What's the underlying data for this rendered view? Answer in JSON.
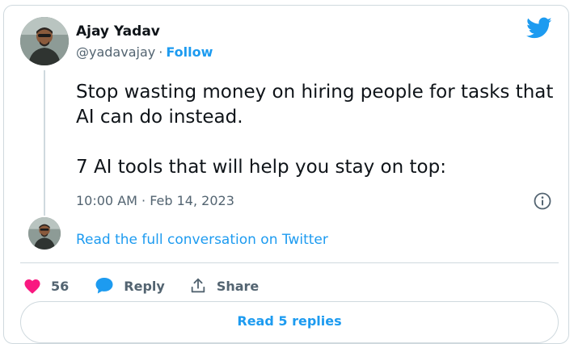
{
  "author": {
    "name": "Ajay Yadav",
    "handle": "@yadavajay",
    "separator": "·",
    "follow_label": "Follow"
  },
  "tweet": {
    "paragraphs": [
      "Stop wasting money on hiring people for tasks that AI can do instead.",
      "7 AI tools that will help you stay on top:"
    ],
    "timestamp": "10:00 AM · Feb 14, 2023"
  },
  "conversation_link": "Read the full conversation on Twitter",
  "actions": {
    "like_count": "56",
    "reply_label": "Reply",
    "share_label": "Share"
  },
  "read_replies_label": "Read 5 replies",
  "icons": {
    "brand": "twitter-bird-icon",
    "info": "info-icon",
    "like": "heart-icon",
    "reply": "speech-bubble-icon",
    "share": "share-arrow-icon"
  },
  "colors": {
    "accent": "#1d9bf0",
    "like": "#f91880",
    "muted": "#536471",
    "text": "#0f1419",
    "border": "#cfd9de"
  }
}
